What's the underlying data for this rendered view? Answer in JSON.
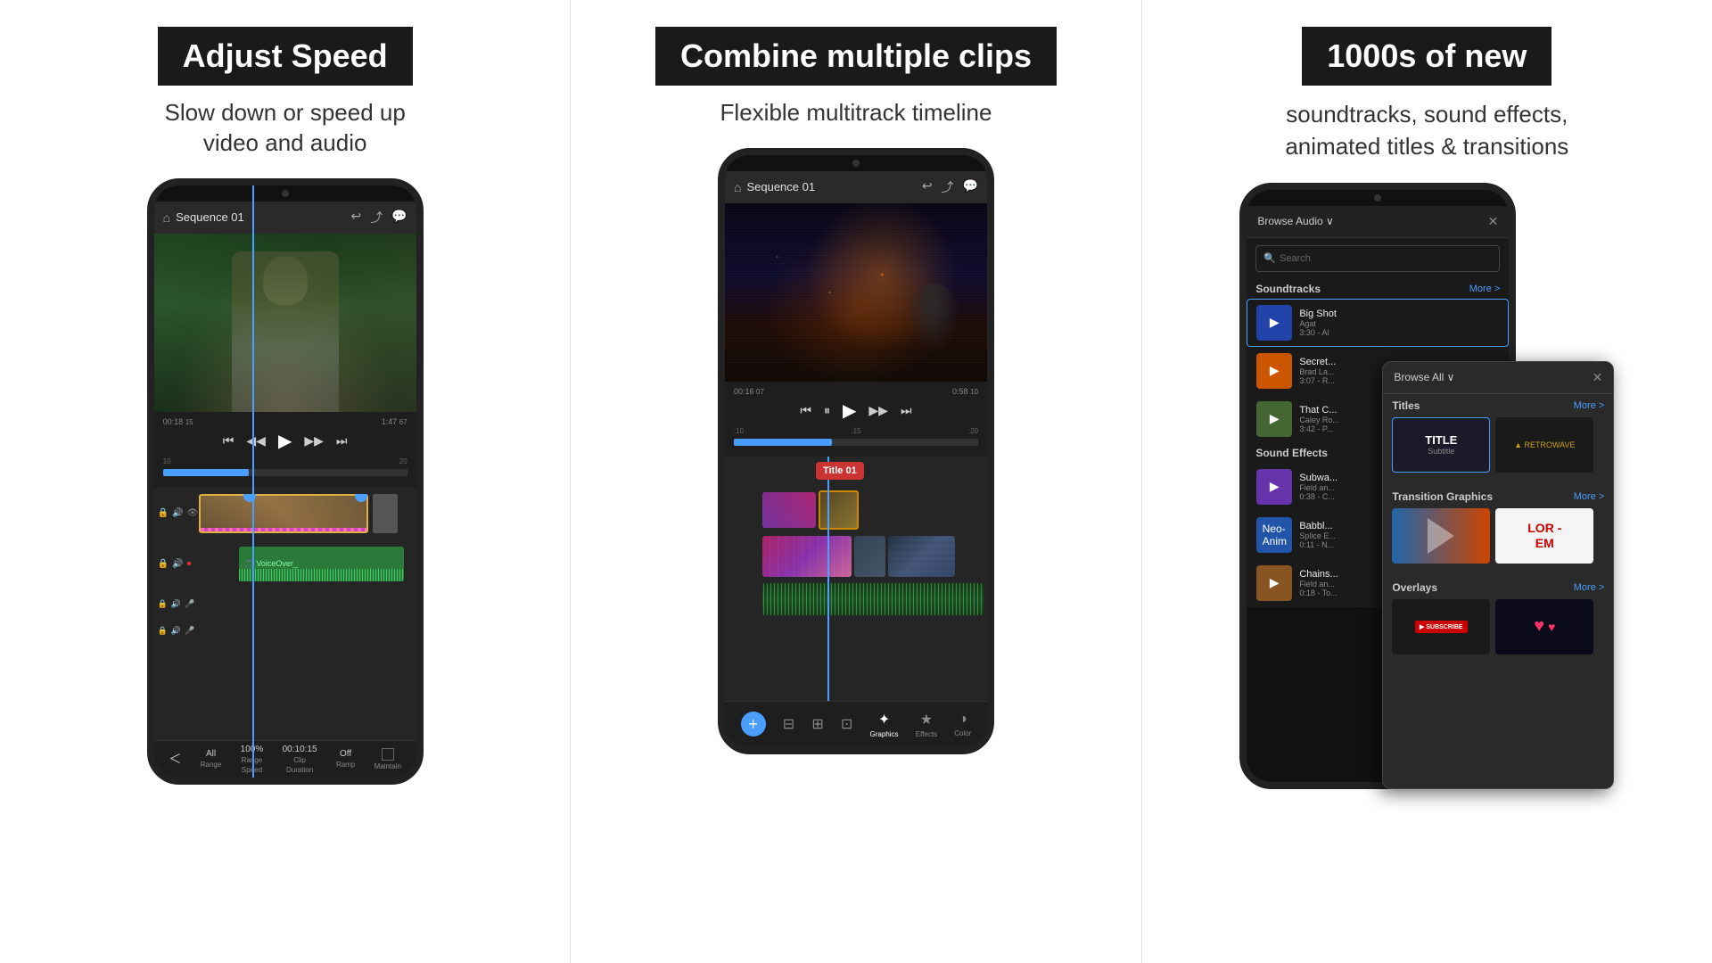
{
  "section1": {
    "title": "Adjust Speed",
    "subtitle": "Slow down or speed up\nvideo and audio",
    "phone": {
      "header_title": "Sequence 01",
      "time1": "00:18",
      "time1b": "15",
      "time2": "1:47",
      "time2b": "67",
      "label_10": "10",
      "label_20": "20",
      "voiceover": "🎵 VoiceOver_",
      "track_icons": [
        "🔒",
        "🔊",
        "👁",
        "🔒",
        "🔊",
        "⏺",
        "🔒",
        "🔊",
        "🎤",
        "🔒",
        "🔊",
        "🎤"
      ]
    },
    "footer": {
      "range_label": "Range",
      "speed_label": "Range\nSpeed",
      "duration_label": "Clip\nDuration",
      "ramp_label": "Ramp",
      "maintain_label": "Maintain",
      "speed_value": "100%",
      "duration_value": "00:10:15",
      "off_value": "Off"
    }
  },
  "section2": {
    "title": "Combine multiple clips",
    "subtitle": "Flexible multitrack timeline",
    "phone": {
      "header_title": "Sequence 01",
      "time1": "00:16",
      "time1b": "07",
      "time2": "0:58",
      "time2b": "10",
      "label_10": ":10",
      "label_15": ":15",
      "label_20": ":20",
      "title_clip": "Title 01"
    },
    "footer_items": [
      "add",
      "trim",
      "split",
      "crop",
      "graphics",
      "effects",
      "color"
    ],
    "footer_labels": [
      "",
      "",
      "",
      "",
      "Graphics",
      "Effects",
      "Color"
    ]
  },
  "section3": {
    "title": "1000s of new",
    "subtitle": "soundtracks, sound effects,\nanimated titles & transitions",
    "browse_panel": {
      "title": "Browse Audio ∨",
      "search_placeholder": "Search",
      "soundtracks_label": "Soundtracks",
      "more_label": "More >",
      "items": [
        {
          "title": "Big Shot",
          "meta": "Agat\n3:30 - Al",
          "bg": "#2244aa"
        },
        {
          "title": "Secret...",
          "meta": "Brad La...\n3:07 - R...",
          "bg": "#cc5500"
        },
        {
          "title": "That C...",
          "meta": "Caley Ro...\n3:42 - P...",
          "bg": "#446633"
        }
      ],
      "sound_effects_label": "Sound Effects",
      "sound_effects_items": [
        {
          "title": "Subwa...",
          "meta": "Field an...\n0:38 - C...",
          "bg": "#6633aa"
        },
        {
          "title": "Babbl...",
          "meta": "Splice E...\n0:11 - N...",
          "bg": "#2255aa"
        },
        {
          "title": "Chains...",
          "meta": "Field an...\n0:18 - To...",
          "bg": "#885522"
        }
      ]
    },
    "browse_all_panel": {
      "title": "Browse All ∨",
      "titles_label": "Titles",
      "more1": "More >",
      "transition_label": "Transition Graphics",
      "more2": "More >",
      "overlays_label": "Overlays",
      "more3": "More >",
      "title_tile1": {
        "main": "TITLE",
        "sub": "Subtitle"
      },
      "lorem_text": "LOR -\nEM",
      "subscribe_text": "▶ SUBSCRIBE"
    }
  }
}
